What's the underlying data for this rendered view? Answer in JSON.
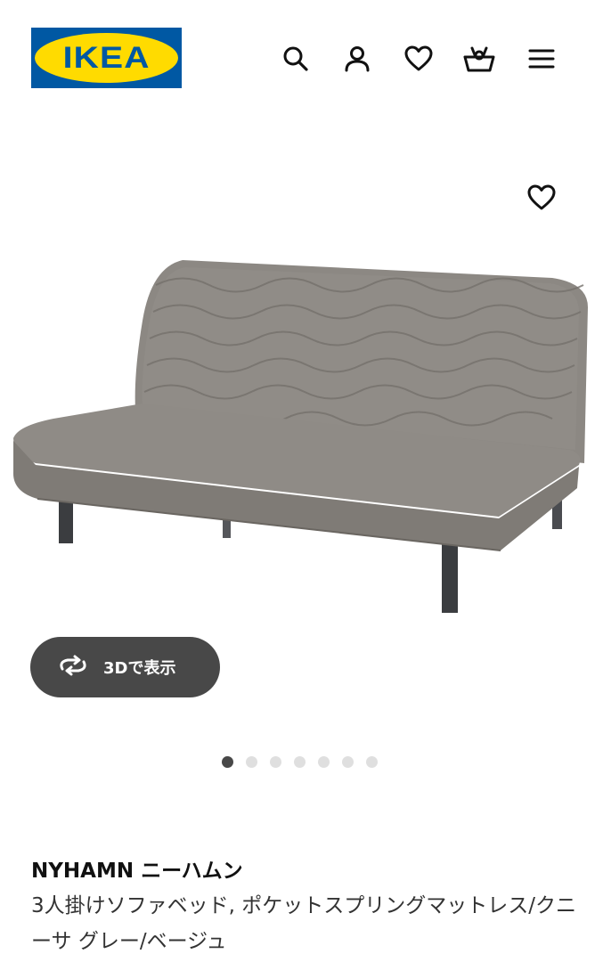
{
  "header": {
    "logo_text": "IKEA",
    "icons": [
      "search-icon",
      "user-icon",
      "heart-icon",
      "cart-icon",
      "menu-icon"
    ]
  },
  "product": {
    "favorite_icon": "heart-icon",
    "view_3d_label": "3Dで表示",
    "view_3d_icon": "rotate-3d-icon",
    "gallery": {
      "total": 7,
      "active_index": 1
    },
    "name": "NYHAMN ニーハムン",
    "description": "3人掛けソファベッド, ポケットスプリングマットレス/クニーサ グレー/ベージュ"
  },
  "colors": {
    "brand_blue": "#0058a3",
    "brand_yellow": "#ffdb00",
    "button_dark": "#484848"
  }
}
